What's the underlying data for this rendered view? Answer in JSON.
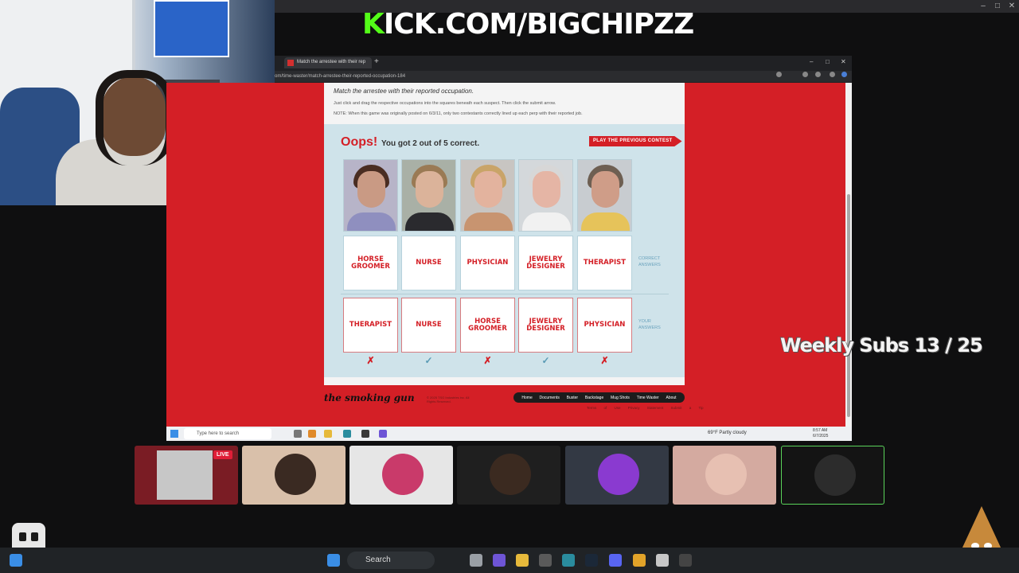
{
  "stream": {
    "banner_k": "K",
    "banner_rest": "ICK.COM/BIGCHIPZZ",
    "weekly_subs": "Weekly Subs  13 / 25",
    "live_badge": "LIVE"
  },
  "browser": {
    "tab_title": "Match the arrestee with their rep",
    "url": "om/time-waster/match-arrestee-their-reported-occupation-184",
    "new_tab": "+",
    "min": "–",
    "max": "□",
    "close": "✕"
  },
  "page": {
    "title": "Match the arrestee with their reported occupation.",
    "instructions": "Just click and drag the respective occupations into the squares beneath each suspect. Then click the submit arrow.",
    "note": "NOTE: When this game was originally posted on 6/3/11, only two contestants correctly lined up each perp with their reported job.",
    "oops": "Oops!",
    "score": "You got 2 out of 5 correct.",
    "prev_button": "PLAY THE PREVIOUS CONTEST",
    "correct_label": "CORRECT ANSWERS",
    "your_label": "YOUR ANSWERS",
    "correct_answers": [
      "HORSE GROOMER",
      "NURSE",
      "PHYSICIAN",
      "JEWELRY DESIGNER",
      "THERAPIST"
    ],
    "user_answers": [
      "THERAPIST",
      "NURSE",
      "HORSE GROOMER",
      "JEWELRY DESIGNER",
      "PHYSICIAN"
    ],
    "results": [
      "✗",
      "✓",
      "✗",
      "✓",
      "✗"
    ]
  },
  "footer": {
    "logo": "the smoking gun",
    "copyright": "© 2025 TSG Industries inc. All Rights Reserved.",
    "nav": [
      "Home",
      "Documents",
      "Buster",
      "Backstage",
      "Mug Shots",
      "Time Waster",
      "About"
    ],
    "links": "Terms of Use  Privacy Statement  Submit a Tip"
  },
  "inner_taskbar": {
    "search": "Type here to search",
    "weather": "69°F  Partly cloudy",
    "time": "8:57 AM",
    "date": "6/7/2025"
  },
  "taskbar": {
    "search": "Search"
  },
  "colors": {
    "brand_red": "#d41f26",
    "kick_green": "#53fc18",
    "panel_blue": "#cfe3ea"
  }
}
